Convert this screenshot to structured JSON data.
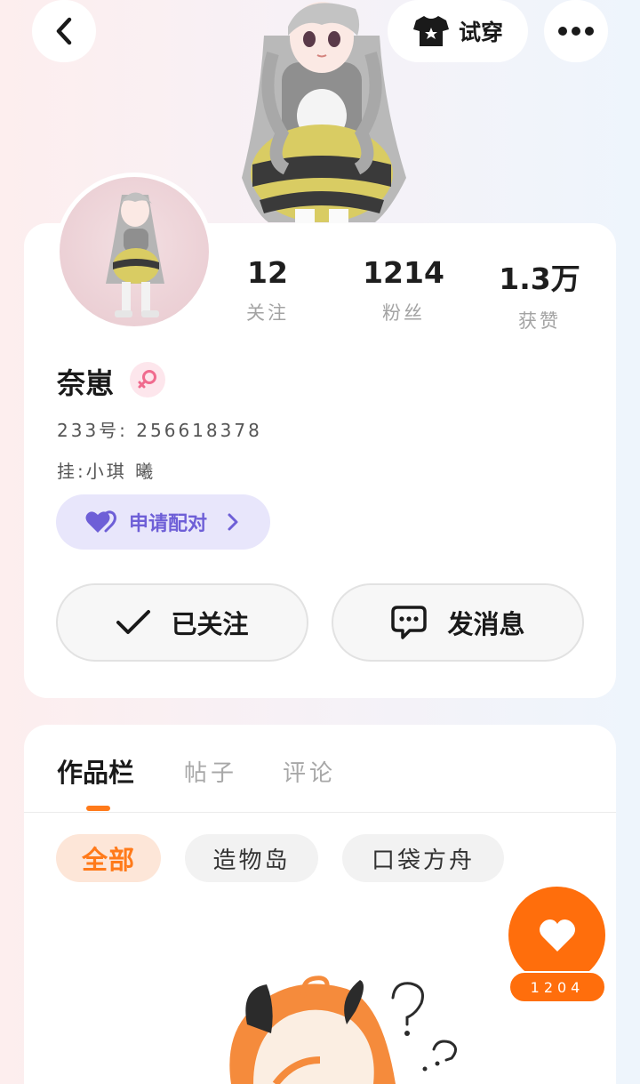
{
  "topbar": {
    "back_icon": "chevron-left-icon",
    "tryon_label": "试穿",
    "tryon_icon": "tshirt-star-icon",
    "more_icon": "more-horizontal-icon"
  },
  "profile": {
    "stats": [
      {
        "value": "12",
        "label": "关注"
      },
      {
        "value": "1214",
        "label": "粉丝"
      },
      {
        "value": "1.3万",
        "label": "获赞"
      }
    ],
    "name": "奈崽",
    "gender_icon": "female-icon",
    "id_line": "233号: 256618378",
    "note_line": "挂:小琪  曦",
    "pair_label": "申请配对",
    "followed_label": "已关注",
    "message_label": "发消息"
  },
  "works": {
    "tabs": [
      "作品栏",
      "帖子",
      "评论"
    ],
    "chips": [
      "全部",
      "造物岛",
      "口袋方舟"
    ],
    "like_count": "1204"
  },
  "colors": {
    "accent": "#ff6e0c",
    "pair_purple": "#6e5fd7",
    "gender_pink": "#f06b8e"
  }
}
